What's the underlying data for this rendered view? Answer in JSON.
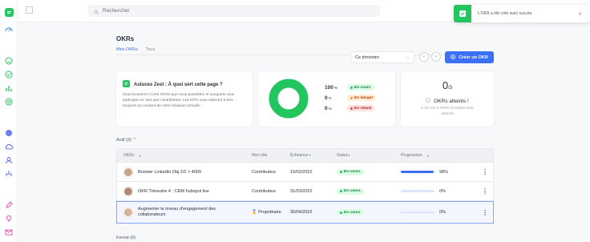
{
  "search": {
    "placeholder": "Rechercher"
  },
  "toast": {
    "message": "L'OKR a été créé avec succès"
  },
  "page": {
    "title": "OKRs"
  },
  "tabs": [
    {
      "label": "Mes OKRs"
    },
    {
      "label": "Tous"
    }
  ],
  "period": {
    "label": "Ce trimestre"
  },
  "create_button": {
    "label": "Créer un OKR"
  },
  "tips": {
    "title": "Astuces Zest : À quoi sert cette page ?",
    "body": "Vous trouverez ici les OKRs que vous possédez et auxquels vous participez en tant que contributeur. Les KPIs vous aideront à être toujours au courant de votre situation actuelle."
  },
  "status_summary": [
    {
      "value": "100",
      "unit": "%",
      "label": "En cours",
      "color": "#22c55e"
    },
    {
      "value": "0",
      "unit": "%",
      "label": "En danger",
      "color": "#f59e0b"
    },
    {
      "value": "0",
      "unit": "%",
      "label": "En retard",
      "color": "#ef4444"
    }
  ],
  "reached": {
    "value": "0",
    "unit": "/3",
    "label": "OKRs atteints !",
    "sub": "0 de vos 0 OKRs finalisés sont atteints"
  },
  "active_section": {
    "label": "Actif (3)"
  },
  "closed_section": {
    "label": "Fermé (0)"
  },
  "table": {
    "headers": [
      "OKRs",
      "Mon rôle",
      "Échéance",
      "Statut",
      "Progression"
    ],
    "rows": [
      {
        "name": "Booster LinkedIn Obj 2/2 × 4000",
        "role": "Contributeur",
        "due": "15/02/2022",
        "status": "En cours",
        "progress": "98%",
        "progress_value": 98
      },
      {
        "name": "OKR Trimestre 4 : CRM hubspot live",
        "role": "Contributeur",
        "due": "31/03/2022",
        "status": "En cours",
        "progress": "0%",
        "progress_value": 0
      },
      {
        "name": "Augmenter le niveau d'engagement des collaborateurs",
        "role": "Propriétaire",
        "due": "30/04/2022",
        "status": "En cours",
        "progress": "0%",
        "progress_value": 0
      }
    ]
  },
  "colors": {
    "accent": "#3b6ff5",
    "brand": "#22c55e"
  }
}
